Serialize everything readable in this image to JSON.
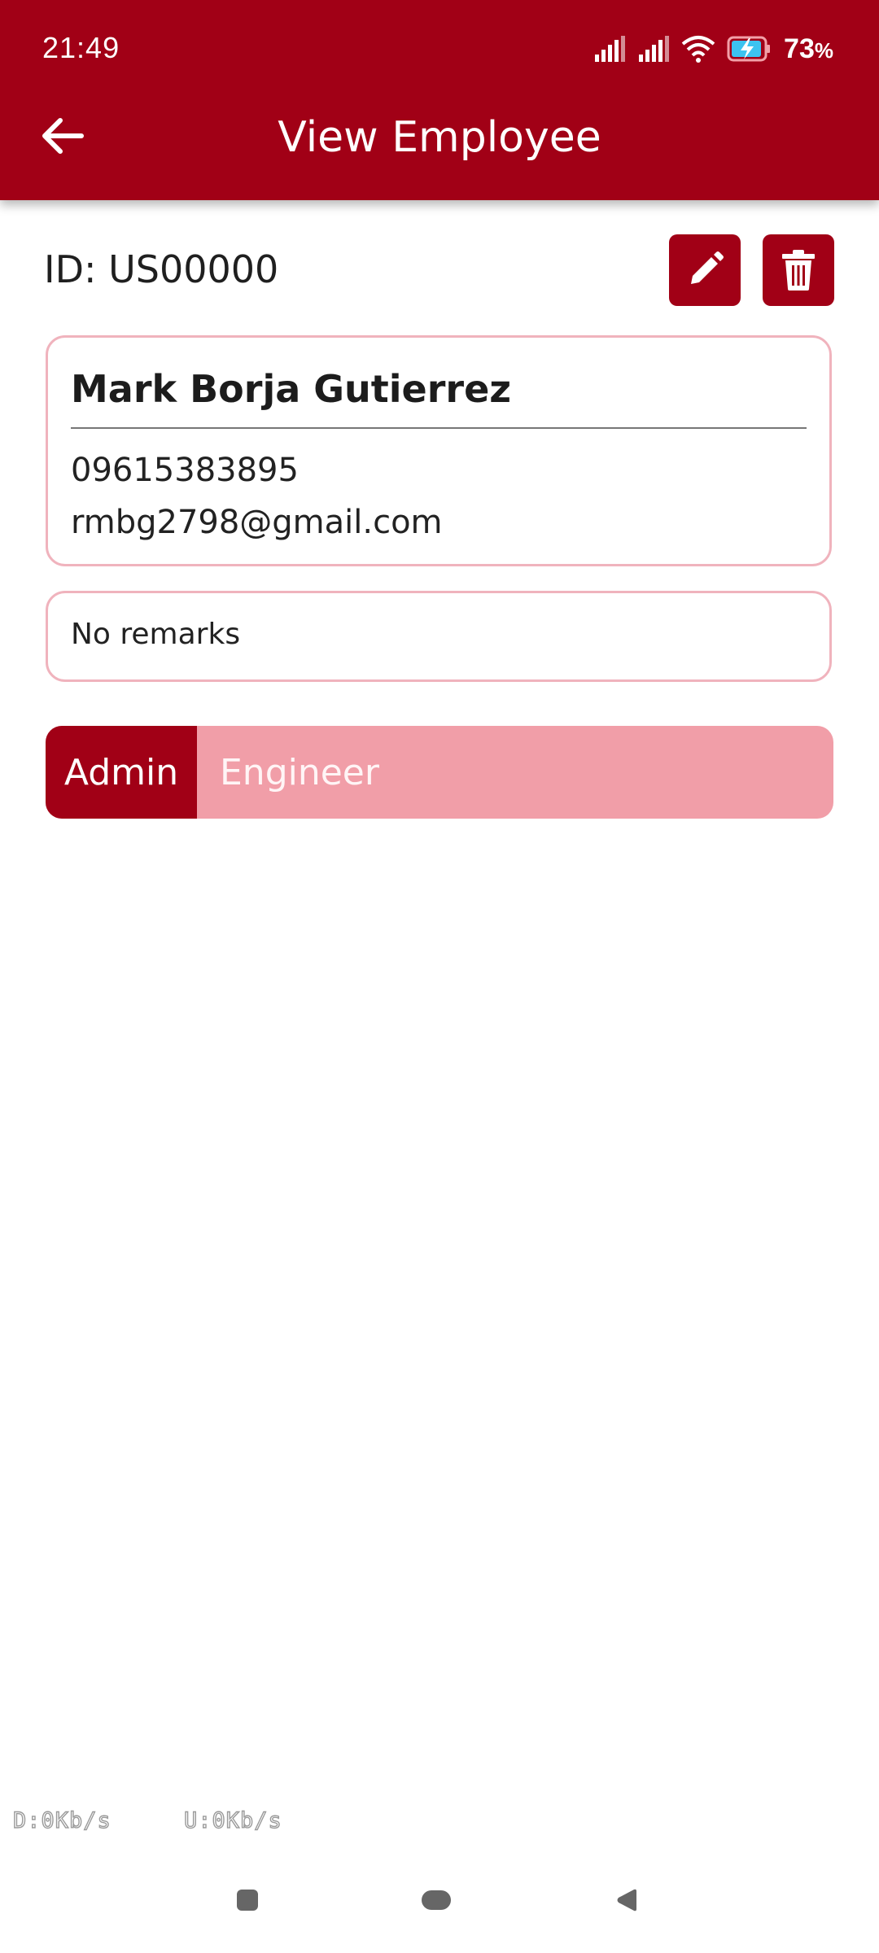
{
  "status_bar": {
    "time": "21:49",
    "battery_percent": "73",
    "battery_suffix": "%",
    "icons": [
      "signal-icon",
      "signal-icon",
      "wifi-icon",
      "battery-charging-icon"
    ]
  },
  "app_bar": {
    "title": "View Employee",
    "back_icon": "arrow-left-icon"
  },
  "employee": {
    "id_label": "ID: US00000",
    "name": "Mark Borja Gutierrez",
    "phone": "09615383895",
    "email": "rmbg2798@gmail.com",
    "remarks": "No remarks"
  },
  "actions": {
    "edit_icon": "pencil-icon",
    "delete_icon": "trash-icon"
  },
  "roles": {
    "options": [
      "Admin",
      "Engineer"
    ],
    "selected": "Admin"
  },
  "network": {
    "download": "D:0Kb/s",
    "upload": "U:0Kb/s"
  },
  "nav_bar": {
    "icons": [
      "recents-icon",
      "home-icon",
      "back-icon"
    ]
  },
  "colors": {
    "primary": "#a10016",
    "card_border": "#f0b3bd",
    "toggle_inactive": "#f19ea8"
  }
}
